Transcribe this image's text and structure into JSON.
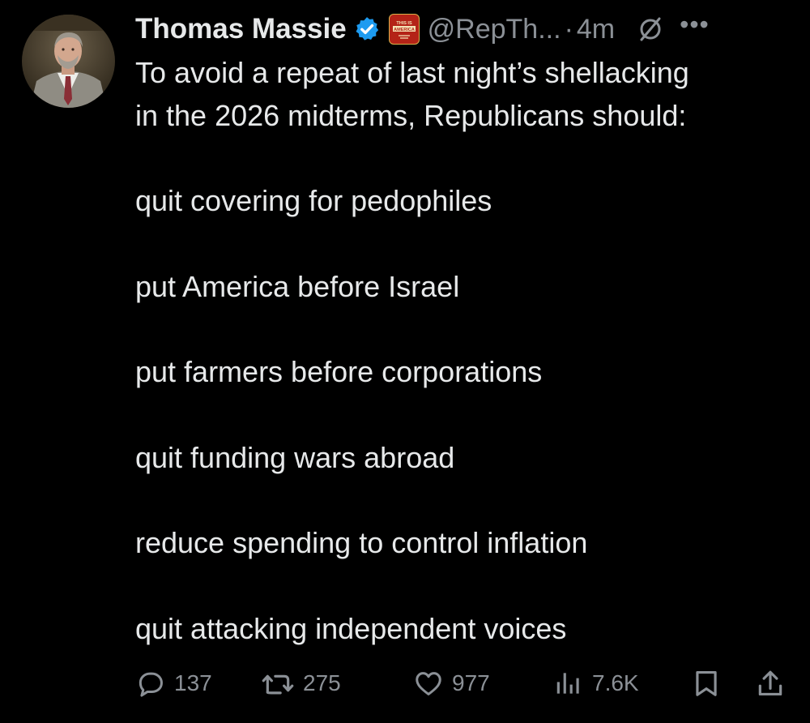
{
  "author": {
    "display_name": "Thomas Massie",
    "handle": "@RepTh...",
    "separator": "·",
    "time": "4m",
    "verified_icon": "verified-badge-icon",
    "affiliate_badge": "THIS IS AMERICA",
    "more_label": "•••"
  },
  "tweet": {
    "intro_line1": "To avoid a repeat of last night’s shellacking",
    "intro_line2": "in the 2026 midterms, Republicans should:",
    "points": [
      "quit covering for pedophiles",
      "put America before Israel",
      "put farmers before corporations",
      "quit funding wars abroad",
      "reduce spending to control inflation",
      "quit attacking independent voices"
    ]
  },
  "actions": {
    "replies": "137",
    "reposts": "275",
    "likes": "977",
    "views": "7.6K"
  },
  "colors": {
    "background": "#000000",
    "text": "#e7e9ea",
    "muted": "#8b9096",
    "verified": "#1d9bf0"
  }
}
